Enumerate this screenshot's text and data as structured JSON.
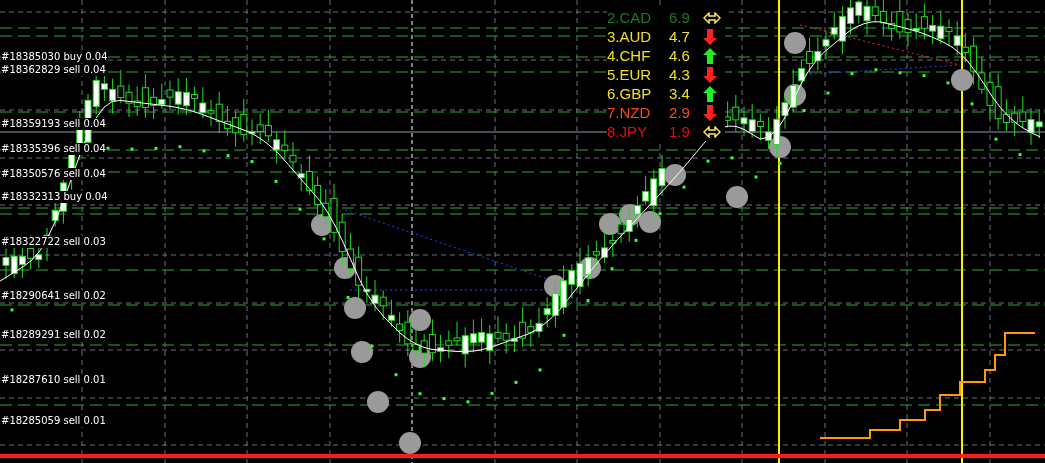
{
  "orders": [
    {
      "label": "#18385030 buy 0.04"
    },
    {
      "label": "#18362829 sell 0.04"
    },
    {
      "label": "#18359193 sell 0.04"
    },
    {
      "label": "#18335396 sell 0.04"
    },
    {
      "label": "#18350576 sell 0.04"
    },
    {
      "label": "#18332313 buy 0.04"
    },
    {
      "label": "#18322722 sell 0.03"
    },
    {
      "label": "#18290641 sell 0.02"
    },
    {
      "label": "#18289291 sell 0.02"
    },
    {
      "label": "#18287610 sell 0.01"
    },
    {
      "label": "#18285059 sell 0.01"
    }
  ],
  "strength": [
    {
      "rank": "2.CAD",
      "value": "6.9",
      "kind": "flat",
      "color": "#1e7a1e"
    },
    {
      "rank": "3.AUD",
      "value": "4.7",
      "kind": "down",
      "color": "#f0e020"
    },
    {
      "rank": "4.CHF",
      "value": "4.6",
      "kind": "up",
      "color": "#f0e020"
    },
    {
      "rank": "5.EUR",
      "value": "4.3",
      "kind": "down",
      "color": "#f0e020"
    },
    {
      "rank": "6.GBP",
      "value": "3.4",
      "kind": "up",
      "color": "#f0e020"
    },
    {
      "rank": "7.NZD",
      "value": "2.9",
      "kind": "down",
      "color": "#ff4a1a"
    },
    {
      "rank": "8.JPY",
      "value": "1.9",
      "kind": "flat",
      "color": "#e01010"
    }
  ]
}
